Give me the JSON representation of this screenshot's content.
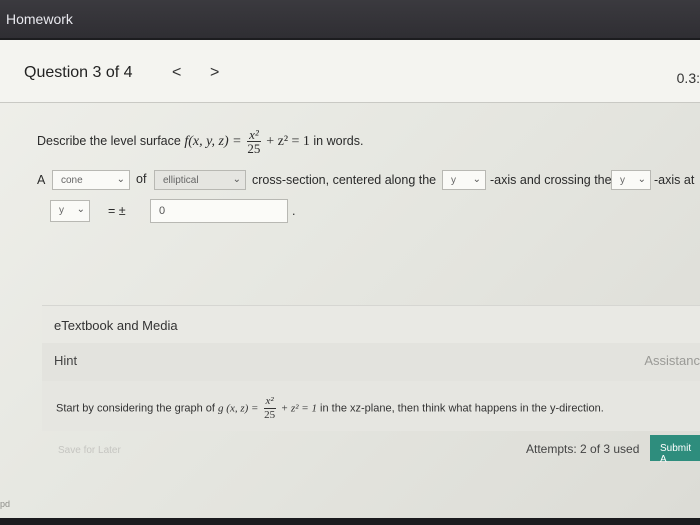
{
  "app": {
    "title": "Homework"
  },
  "question": {
    "title": "Question 3 of 4",
    "prev_label": "<",
    "next_label": ">",
    "score_partial": "0.3:",
    "prompt_prefix": "Describe the level surface",
    "fx": "f(x, y, z) =",
    "fraction": {
      "num": "x²",
      "den": "25"
    },
    "plus_z2": "+ z² = 1",
    "prompt_suffix": "in words."
  },
  "answer_row": {
    "article": "A",
    "surface_select": "cone",
    "of_text": "of",
    "section_select": "elliptical",
    "cross_text": "cross-section, centered along the",
    "axis_select": "y",
    "axis_text": "-axis and crossing the",
    "cross_axis_select": "y",
    "axis_at_text": "-axis at"
  },
  "answer_row2": {
    "var_select": "y",
    "eq_pm": "= ±",
    "value": "0",
    "period": "."
  },
  "sections": {
    "etextbook": "eTextbook and Media",
    "hint": "Hint",
    "assistance": "Assistanc"
  },
  "hint_text": {
    "prefix": "Start by considering the graph of",
    "gx": "g (x, z) =",
    "fraction_num": "x²",
    "fraction_den": "25",
    "plus": "+ z² = 1",
    "suffix": "in the xz-plane, then think what happens in the y-direction."
  },
  "footer": {
    "save_label": "Save for Later",
    "attempts": "Attempts: 2 of 3 used",
    "submit_label": "Submit A"
  },
  "bottom_label": "pd",
  "icons": {
    "prev": "chevron-left-icon",
    "next": "chevron-right-icon",
    "cursor": "mouse-pointer-icon"
  },
  "colors": {
    "submit": "#2e8d7d",
    "topbar": "#3b3a3f"
  }
}
